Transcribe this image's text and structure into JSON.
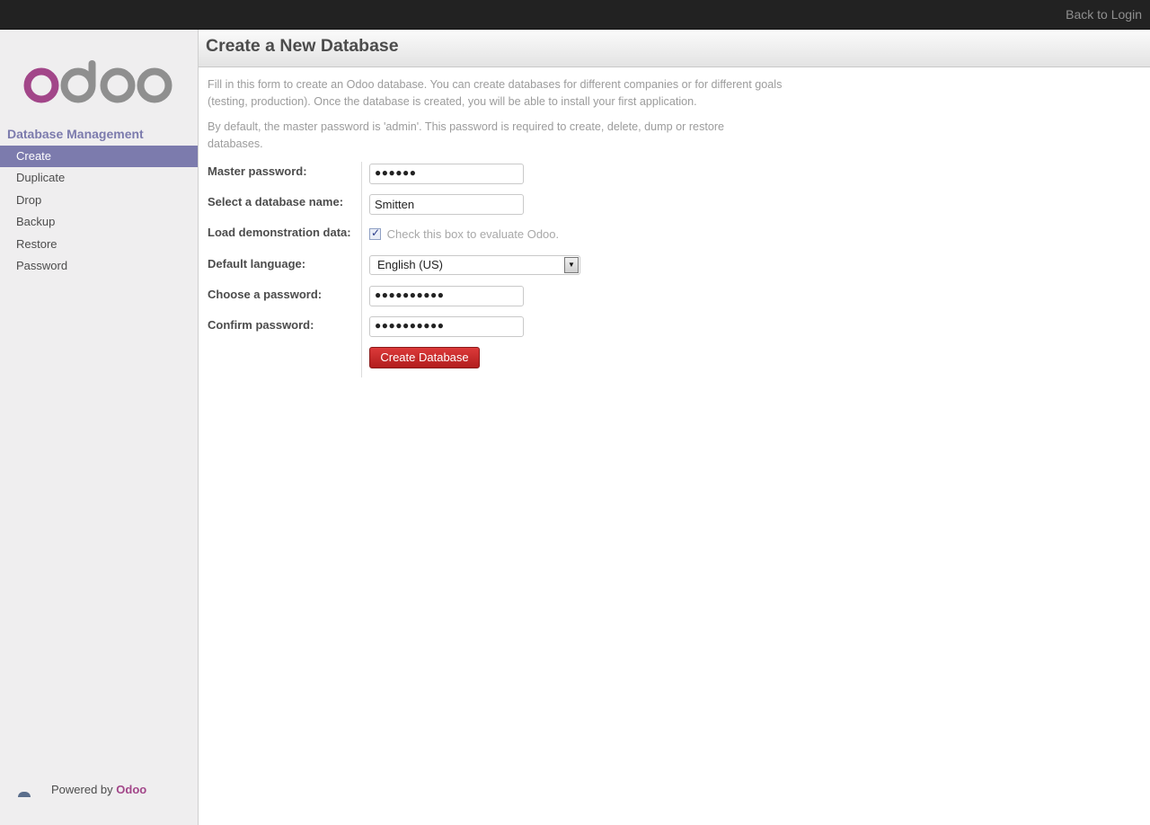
{
  "topbar": {
    "back_to_login": "Back to Login"
  },
  "brand": {
    "logo_text": "odoo",
    "colors": {
      "purple": "#a24689",
      "gray": "#8f8f8f",
      "accent": "#7c7bad",
      "button_red": "#c42b2b"
    }
  },
  "sidebar": {
    "title": "Database Management",
    "items": [
      {
        "label": "Create",
        "active": true
      },
      {
        "label": "Duplicate",
        "active": false
      },
      {
        "label": "Drop",
        "active": false
      },
      {
        "label": "Backup",
        "active": false
      },
      {
        "label": "Restore",
        "active": false
      },
      {
        "label": "Password",
        "active": false
      }
    ],
    "footer": {
      "prefix": "Powered by",
      "brand": "Odoo"
    }
  },
  "main": {
    "title": "Create a New Database",
    "intro_1": "Fill in this form to create an Odoo database. You can create databases for different companies or for different goals (testing, production). Once the database is created, you will be able to install your first application.",
    "intro_2": "By default, the master password is 'admin'. This password is required to create, delete, dump or restore databases.",
    "form": {
      "master_password": {
        "label": "Master password:",
        "value": "●●●●●●"
      },
      "db_name": {
        "label": "Select a database name:",
        "value": "Smitten"
      },
      "demo_data": {
        "label": "Load demonstration data:",
        "checked": true,
        "hint": "Check this box to evaluate Odoo."
      },
      "language": {
        "label": "Default language:",
        "selected": "English (US)"
      },
      "password": {
        "label": "Choose a password:",
        "value": "●●●●●●●●●●"
      },
      "confirm_password": {
        "label": "Confirm password:",
        "value": "●●●●●●●●●●"
      },
      "submit_label": "Create Database"
    }
  }
}
